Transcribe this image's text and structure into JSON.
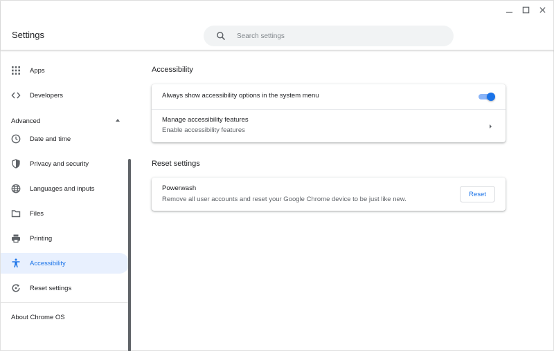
{
  "window": {
    "controls": [
      "minimize",
      "maximize",
      "close"
    ]
  },
  "header": {
    "title": "Settings",
    "search": {
      "placeholder": "Search settings",
      "value": "",
      "icon": "search-icon"
    }
  },
  "sidebar": {
    "items_top": [
      {
        "id": "apps",
        "label": "Apps",
        "icon": "apps-grid-icon"
      },
      {
        "id": "developers",
        "label": "Developers",
        "icon": "code-icon"
      }
    ],
    "advanced": {
      "label": "Advanced",
      "expanded": true
    },
    "items_advanced": [
      {
        "id": "date-time",
        "label": "Date and time",
        "icon": "clock-icon"
      },
      {
        "id": "privacy",
        "label": "Privacy and security",
        "icon": "shield-icon"
      },
      {
        "id": "languages",
        "label": "Languages and inputs",
        "icon": "globe-icon"
      },
      {
        "id": "files",
        "label": "Files",
        "icon": "folder-icon"
      },
      {
        "id": "printing",
        "label": "Printing",
        "icon": "printer-icon"
      },
      {
        "id": "accessibility",
        "label": "Accessibility",
        "icon": "accessibility-icon",
        "active": true
      },
      {
        "id": "reset",
        "label": "Reset settings",
        "icon": "reset-icon"
      }
    ],
    "about": "About Chrome OS"
  },
  "main": {
    "accessibility": {
      "title": "Accessibility",
      "rows": [
        {
          "label": "Always show accessibility options in the system menu",
          "toggle_on": true
        },
        {
          "label": "Manage accessibility features",
          "sublabel": "Enable accessibility features"
        }
      ]
    },
    "reset": {
      "title": "Reset settings",
      "powerwash": {
        "label": "Powerwash",
        "sublabel": "Remove all user accounts and reset your Google Chrome device to be just like new.",
        "button": "Reset"
      }
    }
  },
  "colors": {
    "accent": "#1a73e8",
    "active_bg": "#e8f0fe",
    "icon": "#5f6368"
  }
}
